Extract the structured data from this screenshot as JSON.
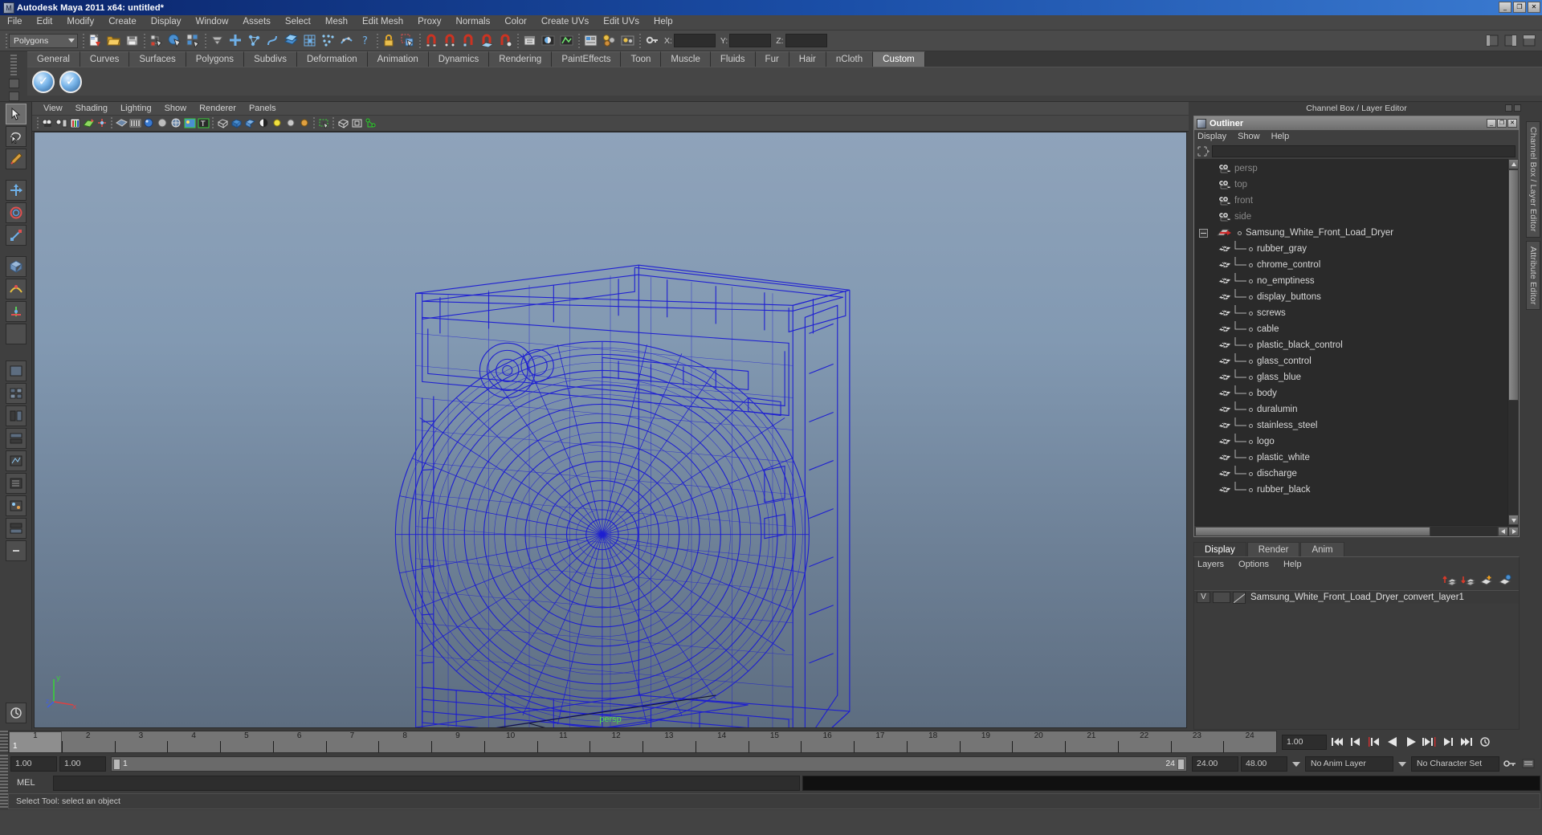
{
  "window": {
    "title": "Autodesk Maya 2011 x64: untitled*",
    "icon": "maya-icon",
    "buttons": [
      "minimize",
      "maximize",
      "close"
    ],
    "button_glyphs": [
      "_",
      "❐",
      "✕"
    ]
  },
  "menubar": {
    "items": [
      "File",
      "Edit",
      "Modify",
      "Create",
      "Display",
      "Window",
      "Assets",
      "Select",
      "Mesh",
      "Edit Mesh",
      "Proxy",
      "Normals",
      "Color",
      "Create UVs",
      "Edit UVs",
      "Help"
    ]
  },
  "statusline": {
    "menuset": "Polygons",
    "axis_labels": [
      "X:",
      "Y:",
      "Z:"
    ],
    "field_values": [
      "",
      "",
      ""
    ]
  },
  "shelf": {
    "tabs": [
      "General",
      "Curves",
      "Surfaces",
      "Polygons",
      "Subdivs",
      "Deformation",
      "Animation",
      "Dynamics",
      "Rendering",
      "PaintEffects",
      "Toon",
      "Muscle",
      "Fluids",
      "Fur",
      "Hair",
      "nCloth",
      "Custom"
    ],
    "active_tab": "Custom",
    "icon_count": 2
  },
  "viewport": {
    "menus": [
      "View",
      "Shading",
      "Lighting",
      "Show",
      "Renderer",
      "Panels"
    ],
    "camera_label": "persp",
    "axis_labels": {
      "x": "x",
      "y": "y",
      "z": "z"
    },
    "model_name": "Samsung White Front Load Dryer wireframe",
    "wire_color": "#1a1ad0",
    "bg_top": "#8fa3ba",
    "bg_bottom": "#5d6d80"
  },
  "rightdock": {
    "header": "Channel Box / Layer Editor",
    "vertical_tabs": [
      "Channel Box / Layer Editor",
      "Attribute Editor"
    ]
  },
  "outliner": {
    "title": "Outliner",
    "window_buttons": [
      "_",
      "❐",
      "✕"
    ],
    "menus": [
      "Display",
      "Show",
      "Help"
    ],
    "search_value": "",
    "items": [
      {
        "label": "persp",
        "icon": "camera-icon",
        "dim": true,
        "child": false,
        "expander": false
      },
      {
        "label": "top",
        "icon": "camera-icon",
        "dim": true,
        "child": false,
        "expander": false
      },
      {
        "label": "front",
        "icon": "camera-icon",
        "dim": true,
        "child": false,
        "expander": false
      },
      {
        "label": "side",
        "icon": "camera-icon",
        "dim": true,
        "child": false,
        "expander": false
      },
      {
        "label": "Samsung_White_Front_Load_Dryer",
        "icon": "group-icon",
        "dim": false,
        "child": false,
        "expander": true
      },
      {
        "label": "rubber_gray",
        "icon": "mesh-icon",
        "dim": false,
        "child": true,
        "expander": false
      },
      {
        "label": "chrome_control",
        "icon": "mesh-icon",
        "dim": false,
        "child": true,
        "expander": false
      },
      {
        "label": "no_emptiness",
        "icon": "mesh-icon",
        "dim": false,
        "child": true,
        "expander": false
      },
      {
        "label": "display_buttons",
        "icon": "mesh-icon",
        "dim": false,
        "child": true,
        "expander": false
      },
      {
        "label": "screws",
        "icon": "mesh-icon",
        "dim": false,
        "child": true,
        "expander": false
      },
      {
        "label": "cable",
        "icon": "mesh-icon",
        "dim": false,
        "child": true,
        "expander": false
      },
      {
        "label": "plastic_black_control",
        "icon": "mesh-icon",
        "dim": false,
        "child": true,
        "expander": false
      },
      {
        "label": "glass_control",
        "icon": "mesh-icon",
        "dim": false,
        "child": true,
        "expander": false
      },
      {
        "label": "glass_blue",
        "icon": "mesh-icon",
        "dim": false,
        "child": true,
        "expander": false
      },
      {
        "label": "body",
        "icon": "mesh-icon",
        "dim": false,
        "child": true,
        "expander": false
      },
      {
        "label": "duralumin",
        "icon": "mesh-icon",
        "dim": false,
        "child": true,
        "expander": false
      },
      {
        "label": "stainless_steel",
        "icon": "mesh-icon",
        "dim": false,
        "child": true,
        "expander": false
      },
      {
        "label": "logo",
        "icon": "mesh-icon",
        "dim": false,
        "child": true,
        "expander": false
      },
      {
        "label": "plastic_white",
        "icon": "mesh-icon",
        "dim": false,
        "child": true,
        "expander": false
      },
      {
        "label": "discharge",
        "icon": "mesh-icon",
        "dim": false,
        "child": true,
        "expander": false
      },
      {
        "label": "rubber_black",
        "icon": "mesh-icon",
        "dim": false,
        "child": true,
        "expander": false
      }
    ]
  },
  "layer_editor": {
    "tabs": [
      "Display",
      "Render",
      "Anim"
    ],
    "active_tab": "Display",
    "menus": [
      "Layers",
      "Options",
      "Help"
    ],
    "layers": [
      {
        "visibility": "V",
        "type": "",
        "name": "Samsung_White_Front_Load_Dryer_convert_layer1"
      }
    ]
  },
  "timeslider": {
    "ticks": [
      1,
      2,
      3,
      4,
      5,
      6,
      7,
      8,
      9,
      10,
      11,
      12,
      13,
      14,
      15,
      16,
      17,
      18,
      19,
      20,
      21,
      22,
      23,
      24
    ],
    "current_frame": "1",
    "current_time_field": "1.00"
  },
  "rangeslider": {
    "anim_start": "1.00",
    "range_start": "1.00",
    "bar_left_value": "1",
    "bar_right_value": "24",
    "range_end": "24.00",
    "anim_end": "48.00",
    "anim_layer": "No Anim Layer",
    "character_set": "No Character Set"
  },
  "commandline": {
    "label": "MEL",
    "input_value": ""
  },
  "helpline": {
    "text": "Select Tool: select an object"
  }
}
